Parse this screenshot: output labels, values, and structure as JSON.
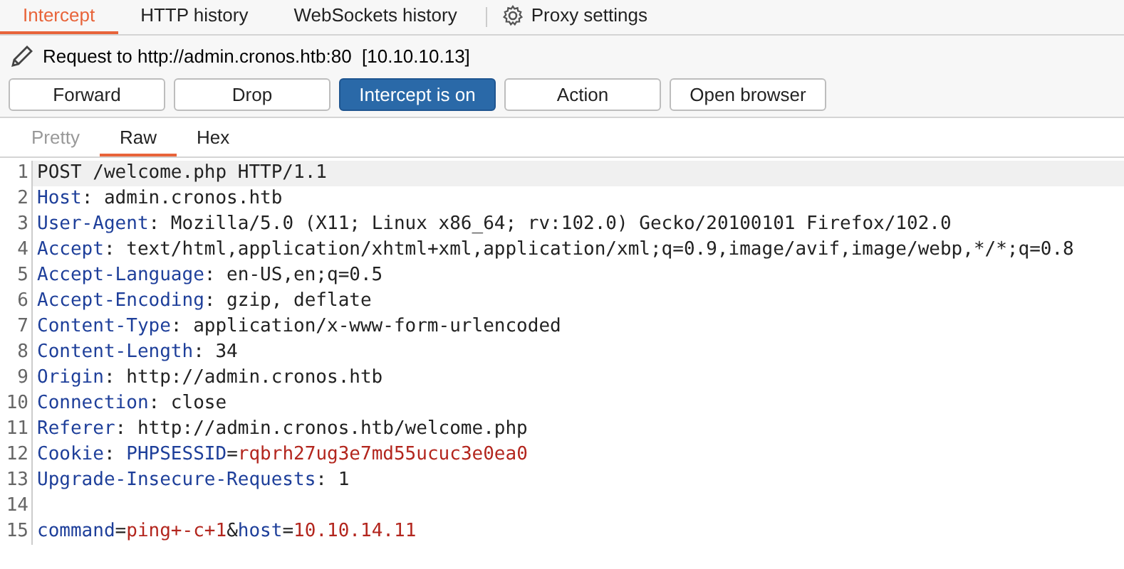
{
  "tabs": [
    {
      "label": "Intercept",
      "selected": true
    },
    {
      "label": "HTTP history",
      "selected": false
    },
    {
      "label": "WebSockets history",
      "selected": false
    },
    {
      "label": "Proxy settings",
      "selected": false,
      "kind": "settings"
    }
  ],
  "request_info": {
    "label": "Request to http://admin.cronos.htb:80",
    "address": "[10.10.10.13]"
  },
  "buttons": [
    {
      "label": "Forward",
      "selected": false
    },
    {
      "label": "Drop",
      "selected": false
    },
    {
      "label": "Intercept is on",
      "selected": true
    },
    {
      "label": "Action",
      "selected": false
    },
    {
      "label": "Open browser",
      "selected": false
    }
  ],
  "view_tabs": [
    {
      "label": "Pretty",
      "selected": false,
      "disabled": true
    },
    {
      "label": "Raw",
      "selected": true,
      "disabled": false
    },
    {
      "label": "Hex",
      "selected": false,
      "disabled": false
    }
  ],
  "editor": {
    "lines": [
      {
        "number": "1",
        "current": true,
        "segments": [
          {
            "kind": "plain",
            "text": "POST /welcome.php HTTP/1.1"
          }
        ]
      },
      {
        "number": "2",
        "current": false,
        "segments": [
          {
            "kind": "key",
            "text": "Host"
          },
          {
            "kind": "plain",
            "text": ": admin.cronos.htb"
          }
        ]
      },
      {
        "number": "3",
        "current": false,
        "segments": [
          {
            "kind": "key",
            "text": "User-Agent"
          },
          {
            "kind": "plain",
            "text": ": Mozilla/5.0 (X11; Linux x86_64; rv:102.0) Gecko/20100101 Firefox/102.0"
          }
        ]
      },
      {
        "number": "4",
        "current": false,
        "segments": [
          {
            "kind": "key",
            "text": "Accept"
          },
          {
            "kind": "plain",
            "text": ": text/html,application/xhtml+xml,application/xml;q=0.9,image/avif,image/webp,*/*;q=0.8"
          }
        ]
      },
      {
        "number": "5",
        "current": false,
        "segments": [
          {
            "kind": "key",
            "text": "Accept-Language"
          },
          {
            "kind": "plain",
            "text": ": en-US,en;q=0.5"
          }
        ]
      },
      {
        "number": "6",
        "current": false,
        "segments": [
          {
            "kind": "key",
            "text": "Accept-Encoding"
          },
          {
            "kind": "plain",
            "text": ": gzip, deflate"
          }
        ]
      },
      {
        "number": "7",
        "current": false,
        "segments": [
          {
            "kind": "key",
            "text": "Content-Type"
          },
          {
            "kind": "plain",
            "text": ": application/x-www-form-urlencoded"
          }
        ]
      },
      {
        "number": "8",
        "current": false,
        "segments": [
          {
            "kind": "key",
            "text": "Content-Length"
          },
          {
            "kind": "plain",
            "text": ": 34"
          }
        ]
      },
      {
        "number": "9",
        "current": false,
        "segments": [
          {
            "kind": "key",
            "text": "Origin"
          },
          {
            "kind": "plain",
            "text": ": http://admin.cronos.htb"
          }
        ]
      },
      {
        "number": "10",
        "current": false,
        "segments": [
          {
            "kind": "key",
            "text": "Connection"
          },
          {
            "kind": "plain",
            "text": ": close"
          }
        ]
      },
      {
        "number": "11",
        "current": false,
        "segments": [
          {
            "kind": "key",
            "text": "Referer"
          },
          {
            "kind": "plain",
            "text": ": http://admin.cronos.htb/welcome.php"
          }
        ]
      },
      {
        "number": "12",
        "current": false,
        "segments": [
          {
            "kind": "key",
            "text": "Cookie"
          },
          {
            "kind": "plain",
            "text": ": "
          },
          {
            "kind": "key",
            "text": "PHPSESSID"
          },
          {
            "kind": "plain",
            "text": "="
          },
          {
            "kind": "value",
            "text": "rqbrh27ug3e7md55ucuc3e0ea0"
          }
        ]
      },
      {
        "number": "13",
        "current": false,
        "segments": [
          {
            "kind": "key",
            "text": "Upgrade-Insecure-Requests"
          },
          {
            "kind": "plain",
            "text": ": 1"
          }
        ]
      },
      {
        "number": "14",
        "current": false
      },
      {
        "number": "15",
        "current": false,
        "segments": [
          {
            "kind": "key",
            "text": "command"
          },
          {
            "kind": "plain",
            "text": "="
          },
          {
            "kind": "value",
            "text": "ping+-c+1"
          },
          {
            "kind": "plain",
            "text": "&"
          },
          {
            "kind": "key",
            "text": "host"
          },
          {
            "kind": "plain",
            "text": "="
          },
          {
            "kind": "value",
            "text": "10.10.14.11"
          }
        ]
      }
    ]
  }
}
